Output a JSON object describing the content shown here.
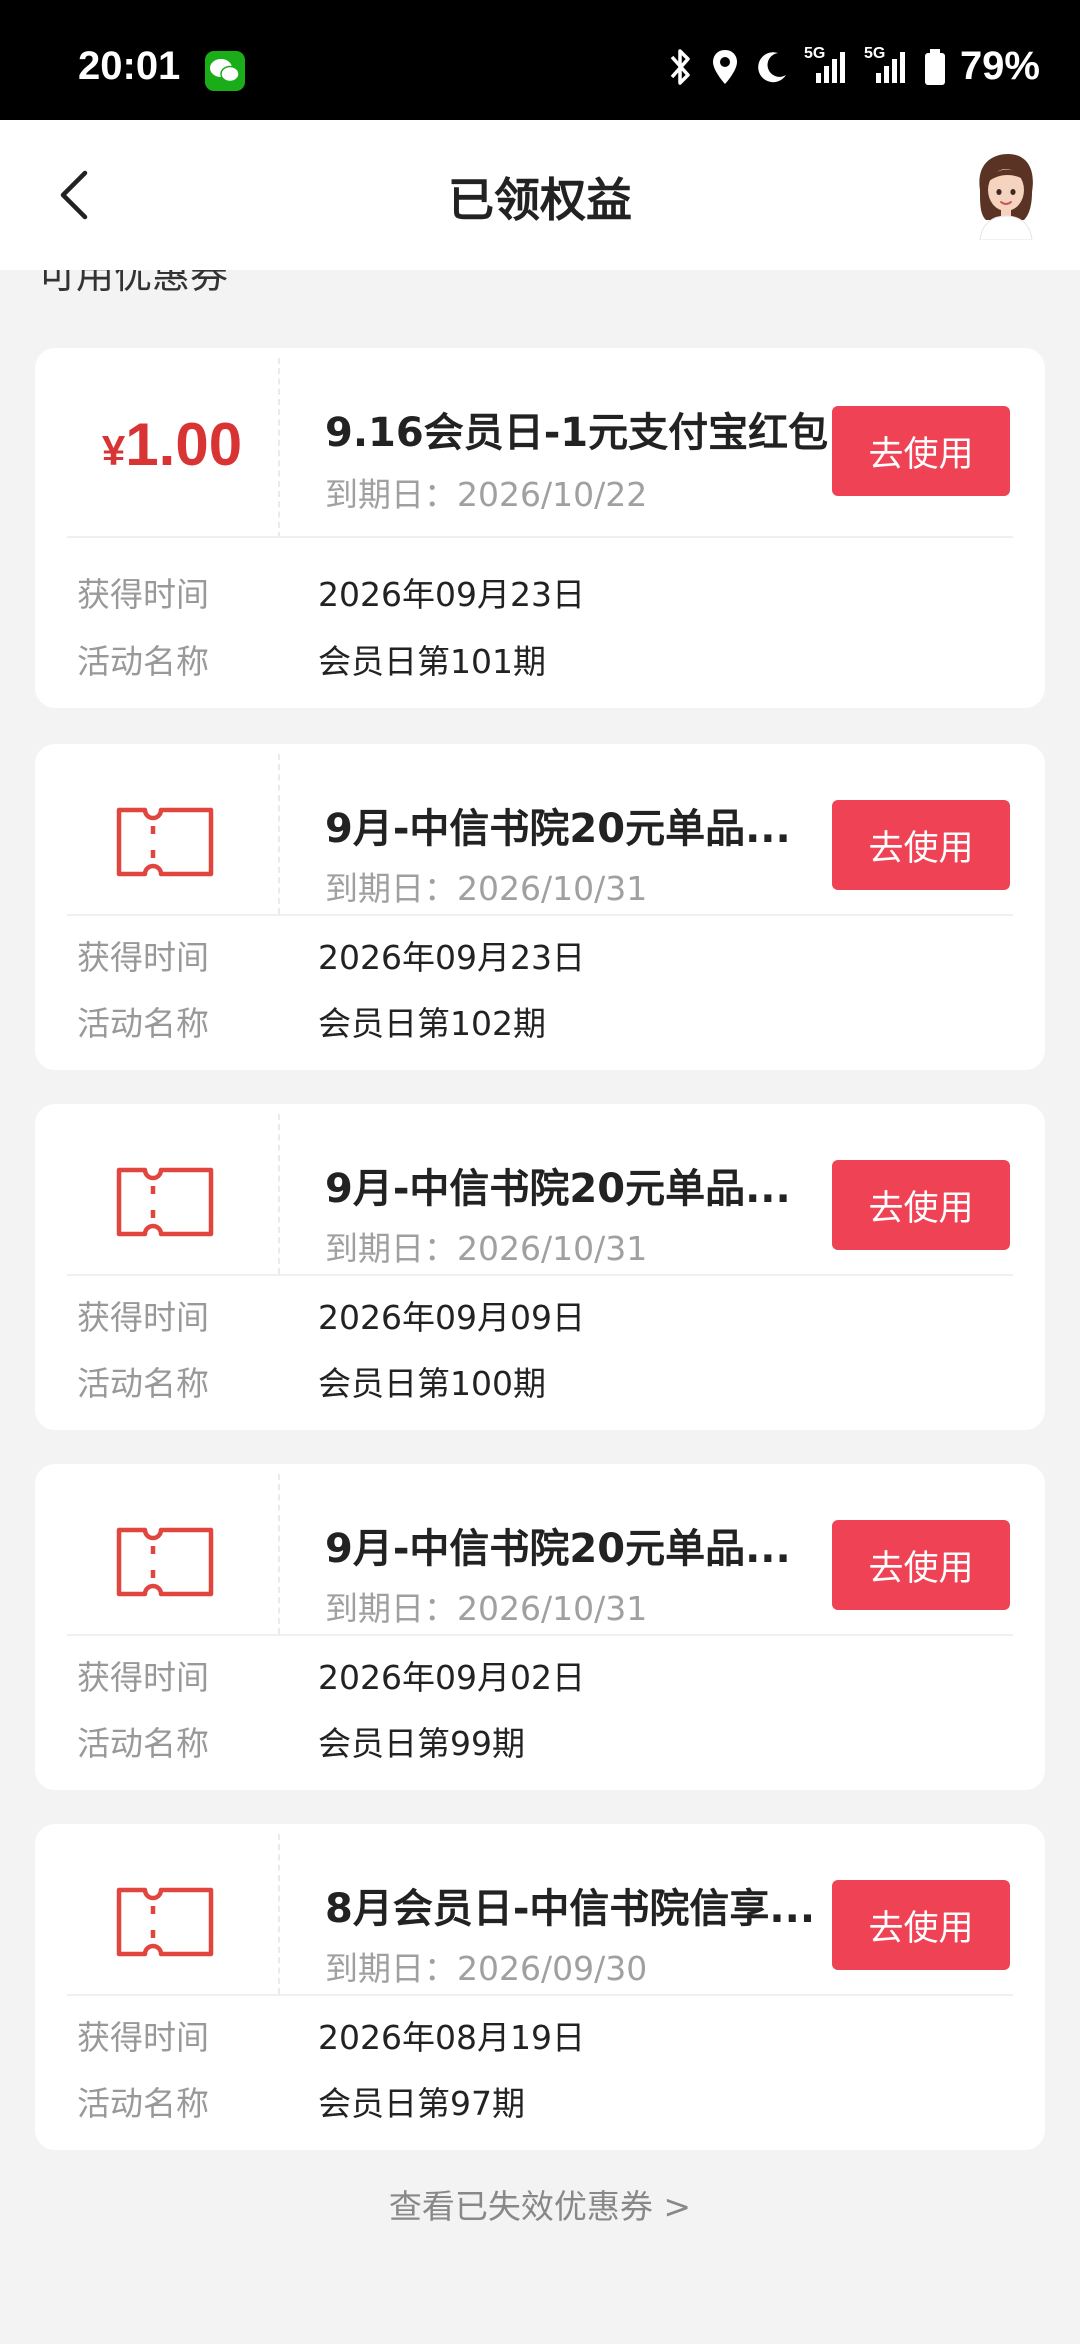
{
  "status_bar": {
    "time": "20:01",
    "battery": "79%",
    "network_1": "5G",
    "network_2": "5G"
  },
  "header": {
    "title": "已领权益"
  },
  "section": {
    "title": "可用优惠券"
  },
  "labels": {
    "acquired_time": "获得时间",
    "activity_name": "活动名称",
    "use_button": "去使用"
  },
  "coupons": [
    {
      "price_symbol": "¥",
      "price_value": "1.00",
      "icon": "red-envelope-amount",
      "name": "9.16会员日-1元支付宝红包",
      "expiry": "到期日：2026/10/22",
      "acquired_time": "2026年09月23日",
      "activity_name": "会员日第101期"
    },
    {
      "icon": "ticket-icon",
      "name": "9月-中信书院20元单品...",
      "expiry": "到期日：2026/10/31",
      "acquired_time": "2026年09月23日",
      "activity_name": "会员日第102期"
    },
    {
      "icon": "ticket-icon",
      "name": "9月-中信书院20元单品...",
      "expiry": "到期日：2026/10/31",
      "acquired_time": "2026年09月09日",
      "activity_name": "会员日第100期"
    },
    {
      "icon": "ticket-icon",
      "name": "9月-中信书院20元单品...",
      "expiry": "到期日：2026/10/31",
      "acquired_time": "2026年09月02日",
      "activity_name": "会员日第99期"
    },
    {
      "icon": "ticket-icon",
      "name": "8月会员日-中信书院信享...",
      "expiry": "到期日：2026/09/30",
      "acquired_time": "2026年08月19日",
      "activity_name": "会员日第97期"
    }
  ],
  "footer": {
    "expired_link": "查看已失效优惠券 >"
  },
  "colors": {
    "accent": "#ef4255",
    "price": "#d93434",
    "ticket": "#e0463e"
  }
}
